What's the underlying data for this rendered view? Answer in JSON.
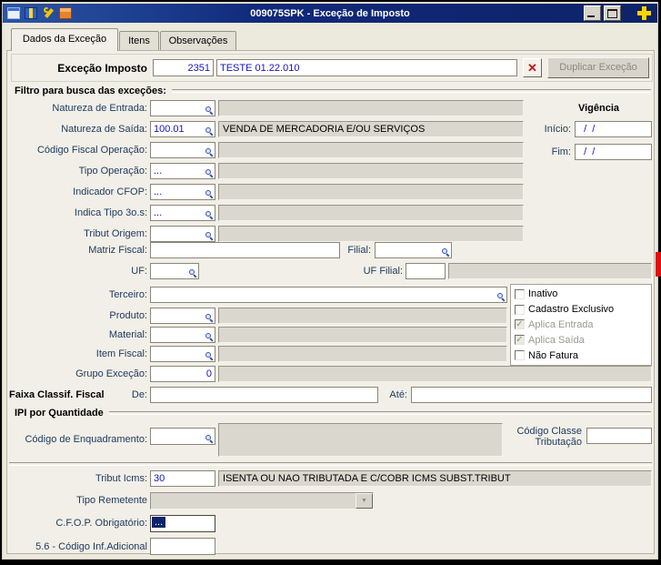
{
  "titlebar": {
    "title": "009075SPK - Exceção de Imposto"
  },
  "tabs": {
    "dados": "Dados da Exceção",
    "itens": "Itens",
    "observacoes": "Observações"
  },
  "header": {
    "label": "Exceção Imposto",
    "code": "2351",
    "description": "TESTE 01.22.010",
    "delete_glyph": "✕",
    "duplicate": "Duplicar Exceção"
  },
  "filtro": {
    "title": "Filtro para busca das exceções:",
    "natureza_entrada_label": "Natureza de Entrada:",
    "natureza_entrada": "",
    "natureza_entrada_desc": "",
    "natureza_saida_label": "Natureza de Saída:",
    "natureza_saida": "100.01",
    "natureza_saida_desc": "VENDA DE MERCADORIA E/OU SERVIÇOS",
    "codigo_fiscal_label": "Código Fiscal Operação:",
    "codigo_fiscal": "",
    "codigo_fiscal_desc": "",
    "tipo_operacao_label": "Tipo Operação:",
    "tipo_operacao": "...",
    "tipo_operacao_desc": "",
    "indicador_cfop_label": "Indicador CFOP:",
    "indicador_cfop": "...",
    "indicador_cfop_desc": "",
    "indica_tipo_label": "Indica Tipo 3o.s:",
    "indica_tipo": "...",
    "indica_tipo_desc": "",
    "tribut_origem_label": "Tribut Origem:",
    "tribut_origem": "",
    "tribut_origem_desc": "",
    "matriz_fiscal_label": "Matriz Fiscal:",
    "matriz_fiscal": "",
    "filial_label": "Filial:",
    "filial": "",
    "uf_label": "UF:",
    "uf": "",
    "uf_filial_label": "UF Filial:",
    "uf_filial": "",
    "uf_filial_desc": "",
    "terceiro_label": "Terceiro:",
    "terceiro": "",
    "produto_label": "Produto:",
    "produto": "",
    "produto_desc": "",
    "material_label": "Material:",
    "material": "",
    "material_desc": "",
    "item_fiscal_label": "Item Fiscal:",
    "item_fiscal": "",
    "item_fiscal_desc": "",
    "grupo_label": "Grupo Exceção:",
    "grupo": "0",
    "grupo_desc": ""
  },
  "vigencia": {
    "title": "Vigência",
    "inicio_label": "Início:",
    "inicio": "  /  /",
    "fim_label": "Fim:",
    "fim": "  /  /"
  },
  "flags": {
    "check": "✓",
    "inativo": "Inativo",
    "cadastro_exclusivo": "Cadastro Exclusivo",
    "aplica_entrada": "Aplica Entrada",
    "aplica_saida": "Aplica Saída",
    "nao_fatura": "Não Fatura"
  },
  "faixa": {
    "title": "Faixa Classif. Fiscal",
    "de_label": "De:",
    "de": "",
    "ate_label": "Até:",
    "ate": ""
  },
  "ipi": {
    "title": "IPI por Quantidade",
    "enq_label": "Código de Enquadramento:",
    "enq": "",
    "enq_desc": "",
    "classe_label_1": "Código Classe",
    "classe_label_2": "Tributação",
    "classe": ""
  },
  "rodape": {
    "icms_label": "Tribut Icms:",
    "icms": "30",
    "icms_desc": "ISENTA OU NAO TRIBUTADA E C/COBR ICMS SUBST.TRIBUT",
    "remetente_label": "Tipo Remetente",
    "remetente": "",
    "arrow": "▼",
    "cfop_label": "C.F.O.P. Obrigatório:",
    "cfop": "...",
    "inf_label": "5.6 - Código Inf.Adicional",
    "inf": ""
  }
}
